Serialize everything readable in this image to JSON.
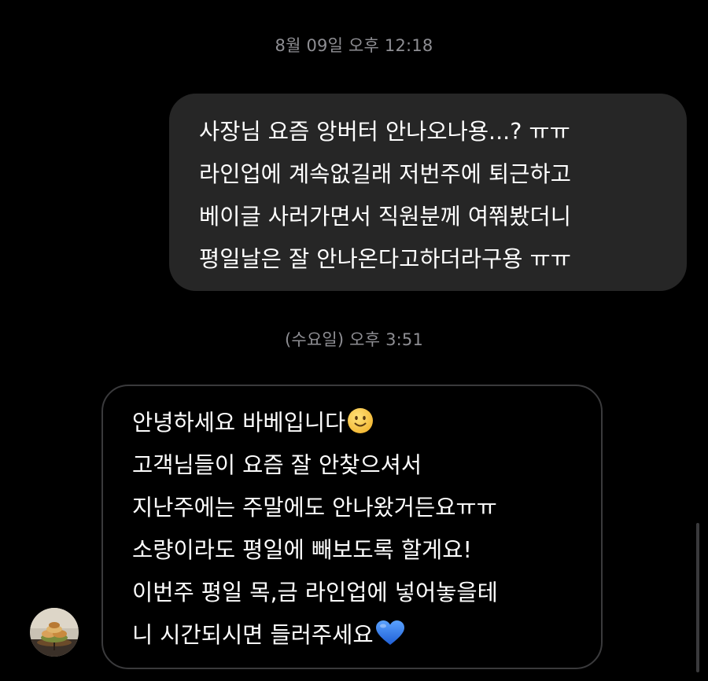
{
  "conversation": {
    "timestamps": [
      "8월 09일 오후 12:18",
      "(수요일) 오후 3:51"
    ],
    "sent_message": {
      "lines": [
        "사장님 요즘 앙버터 안나오나용...? ㅠㅠ",
        "라인업에 계속없길래 저번주에 퇴근하고",
        "베이글 사러가면서 직원분께 여쭤봤더니",
        "평일날은 잘 안나온다고하더라구용 ㅠㅠ"
      ]
    },
    "received_message": {
      "lines": [
        "안녕하세요 바베입니다",
        "고객님들이 요즘 잘 안찾으셔서",
        "지난주에는 주말에도 안나왔거든요ㅠㅠ",
        "소량이라도 평일에 빼보도록 할게요!",
        "이번주 평일 목,금 라인업에 넣어놓을테",
        "니 시간되시면 들러주세요"
      ],
      "emojis": [
        "slightly-smiling-face-emoji",
        "blue-heart-emoji"
      ]
    },
    "avatar": "bagel-shop-avatar"
  },
  "colors": {
    "background": "#000000",
    "sent_bubble": "#262626",
    "received_border": "#3a3a3c",
    "timestamp": "#8e8e93",
    "emoji_yellow": "#f7c948",
    "heart_blue": "#2f7cf6"
  }
}
